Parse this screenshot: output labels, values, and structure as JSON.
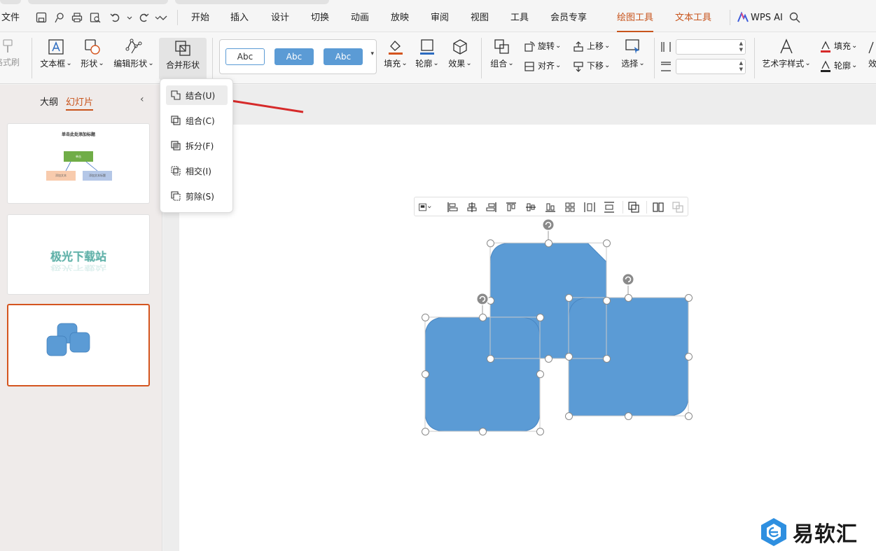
{
  "menubar": {
    "file": "文件",
    "tabs": [
      "开始",
      "插入",
      "设计",
      "切换",
      "动画",
      "放映",
      "审阅",
      "视图",
      "工具",
      "会员专享",
      "绘图工具",
      "文本工具"
    ],
    "wps_ai": "WPS AI"
  },
  "ribbon": {
    "format_painter": "格式刷",
    "textbox": "文本框",
    "shape": "形状",
    "edit_shape": "编辑形状",
    "merge_shape": "合并形状",
    "style_samples": [
      "Abc",
      "Abc",
      "Abc"
    ],
    "fill": "填充",
    "outline": "轮廓",
    "effect": "效果",
    "group": "组合",
    "rotate": "旋转",
    "align": "对齐",
    "bring_forward": "上移",
    "send_backward": "下移",
    "select": "选择",
    "art_style": "艺术字样式",
    "text_fill": "填充",
    "text_outline": "轮廓",
    "text_effect": "效"
  },
  "sidebar": {
    "tab_outline": "大纲",
    "tab_slides": "幻灯片",
    "slide1_title": "单击此处添加标题",
    "slide1_top": "单击",
    "slide1_left": "添加文本",
    "slide1_right": "添加文本标题",
    "slide2_text": "极光下载站"
  },
  "dropdown": {
    "items": [
      "结合(U)",
      "组合(C)",
      "拆分(F)",
      "相交(I)",
      "剪除(S)"
    ]
  },
  "watermark": "易软汇",
  "colors": {
    "accent": "#c8541c",
    "shape_fill": "#5b9bd5",
    "arrow": "#d62a2a",
    "selected_border": "#d4551f"
  }
}
